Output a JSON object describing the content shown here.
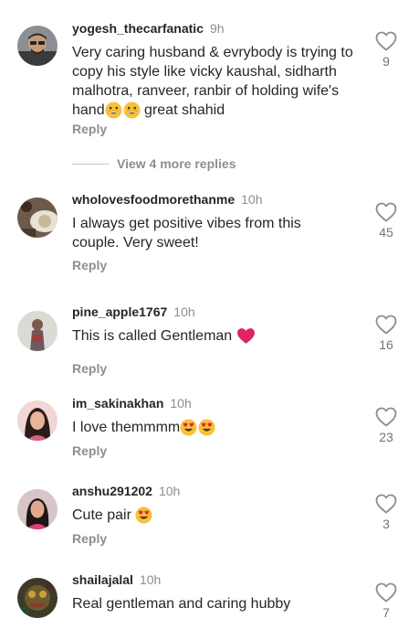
{
  "comments": [
    {
      "username": "yogesh_thecarfanatic",
      "time": "9h",
      "text_lines": [
        "Very caring husband & evrybody is trying to",
        "copy his style like vicky kaushal, sidharth",
        "malhotra, ranveer, ranbir of holding wife's"
      ],
      "text_last_a": "hand",
      "text_last_b": " great shahid",
      "likes": "9",
      "reply": "Reply"
    },
    {
      "username": "wholovesfoodmorethanme",
      "time": "10h",
      "text_lines": [
        "I always get positive vibes from this",
        "couple. Very sweet!"
      ],
      "likes": "45",
      "reply": "Reply"
    },
    {
      "username": "pine_apple1767",
      "time": "10h",
      "text": "This is called Gentleman ",
      "likes": "16",
      "reply": "Reply"
    },
    {
      "username": "im_sakinakhan",
      "time": "10h",
      "text": "I love themmmm",
      "likes": "23",
      "reply": "Reply"
    },
    {
      "username": "anshu291202",
      "time": "10h",
      "text": "Cute pair ",
      "likes": "3",
      "reply": "Reply"
    },
    {
      "username": "shailajalal",
      "time": "10h",
      "text": "Real gentleman and caring hubby",
      "likes": "7"
    }
  ],
  "view_more_replies": "View 4 more replies",
  "icons": {
    "like": "heart-outline-icon",
    "emoji_grin": "grinning-face-emoji",
    "emoji_heart": "red-heart-emoji",
    "emoji_heart_eyes": "heart-eyes-emoji"
  },
  "colors": {
    "text": "#262626",
    "muted": "#8e8e8e",
    "heart": "#e0245e"
  }
}
